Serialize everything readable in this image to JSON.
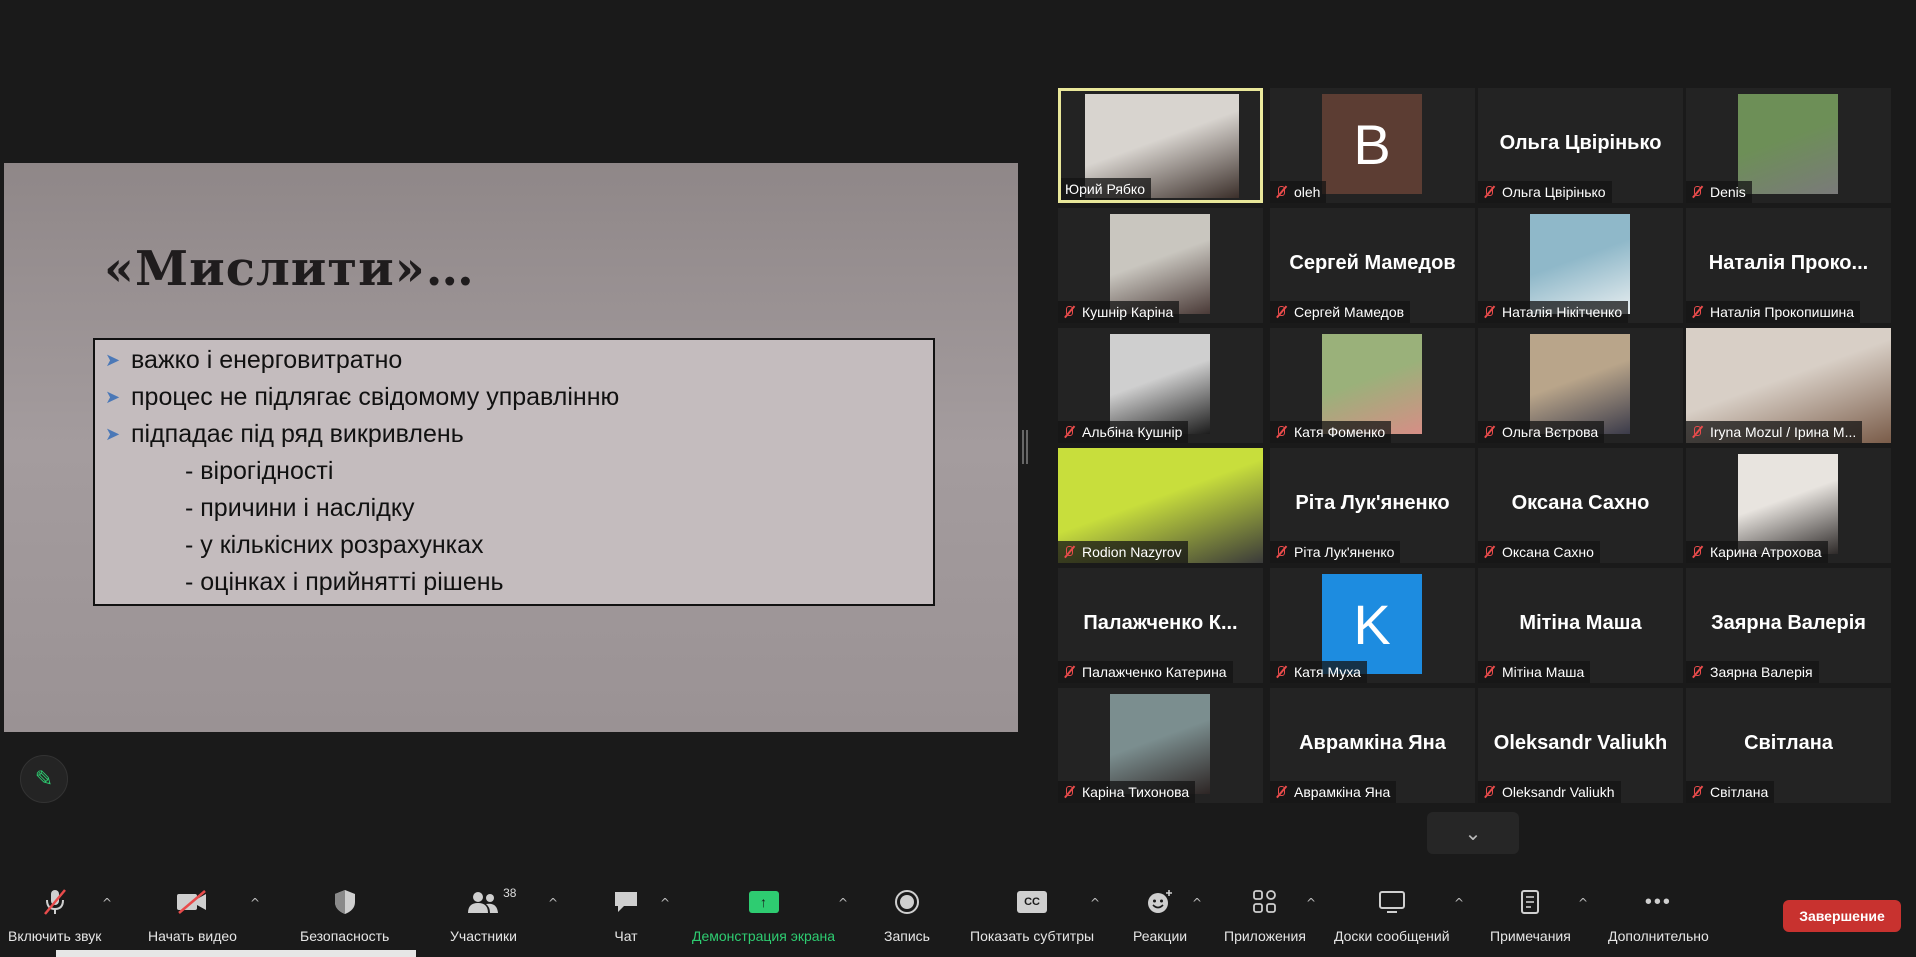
{
  "slide": {
    "title": "«Мислити»…",
    "bullets": [
      "важко і енерговитратно",
      "процес не підлягає свідомому управлінню",
      "підпадає під ряд викривлень"
    ],
    "sub_items": [
      "- вірогідності",
      "- причини і наслідку",
      "- у кількісних розрахунках",
      "- оцінках і прийнятті рішень"
    ]
  },
  "participants": [
    {
      "label": "Юрий Рябко",
      "kind": "video",
      "active": true,
      "muted": false,
      "colors": [
        "#d8d4cf",
        "#3b2f2a"
      ]
    },
    {
      "label": "oleh",
      "kind": "avatar",
      "letter": "B",
      "avatar_color": "#5c3d33",
      "muted": true
    },
    {
      "label": "Ольга Цвірінько",
      "kind": "name",
      "display": "Ольга Цвірінько",
      "muted": true
    },
    {
      "label": "Denis",
      "kind": "video",
      "muted": true,
      "colors": [
        "#6d8f57",
        "#7a7a7a"
      ]
    },
    {
      "label": "Кушнір Каріна",
      "kind": "video",
      "muted": true,
      "colors": [
        "#c9c6bf",
        "#4a3a37"
      ]
    },
    {
      "label": "Сергей Мамедов",
      "kind": "name",
      "display": "Сергей Мамедов",
      "muted": true
    },
    {
      "label": "Наталія Нікітченко",
      "kind": "video",
      "muted": true,
      "colors": [
        "#8fb8c9",
        "#e8eef0"
      ]
    },
    {
      "label": "Наталія Прокопишина",
      "kind": "name",
      "display": "Наталія Проко...",
      "muted": true
    },
    {
      "label": "Альбіна Кушнір",
      "kind": "video",
      "muted": true,
      "colors": [
        "#cfcfcf",
        "#1c1c1c"
      ]
    },
    {
      "label": "Катя Фоменко",
      "kind": "video",
      "muted": true,
      "colors": [
        "#9ab17a",
        "#d68e86"
      ]
    },
    {
      "label": "Ольга Вєтрова",
      "kind": "video",
      "muted": true,
      "colors": [
        "#b9a58a",
        "#3b3b4a"
      ]
    },
    {
      "label": "Iryna Mozul / Ірина М...",
      "kind": "video",
      "muted": true,
      "colors": [
        "#d8cfc6",
        "#7a5c49"
      ]
    },
    {
      "label": "Rodion Nazyrov",
      "kind": "video",
      "muted": true,
      "colors": [
        "#c8de3c",
        "#3a3a3a"
      ]
    },
    {
      "label": "Ріта Лук'яненко",
      "kind": "name",
      "display": "Ріта Лук'яненко",
      "muted": true
    },
    {
      "label": "Оксана Сахно",
      "kind": "name",
      "display": "Оксана Сахно",
      "muted": true
    },
    {
      "label": "Карина Атрохова",
      "kind": "video",
      "muted": true,
      "colors": [
        "#e8e4df",
        "#2e2a29"
      ]
    },
    {
      "label": "Палажченко Катерина",
      "kind": "name",
      "display": "Палажченко К...",
      "muted": true
    },
    {
      "label": "Катя Муха",
      "kind": "avatar",
      "letter": "K",
      "avatar_color": "#1d8ce0",
      "muted": true
    },
    {
      "label": "Мітіна Маша",
      "kind": "name",
      "display": "Мітіна Маша",
      "muted": true
    },
    {
      "label": "Заярна Валерія",
      "kind": "name",
      "display": "Заярна Валерія",
      "muted": true
    },
    {
      "label": "Каріна Тихонова",
      "kind": "video",
      "muted": true,
      "colors": [
        "#7b8e8f",
        "#2d2524"
      ]
    },
    {
      "label": "Аврамкіна Яна",
      "kind": "name",
      "display": "Аврамкіна Яна",
      "muted": true
    },
    {
      "label": "Oleksandr Valiukh",
      "kind": "name",
      "display": "Oleksandr Valiukh",
      "muted": true
    },
    {
      "label": "Світлана",
      "kind": "name",
      "display": "Світлана",
      "muted": true
    }
  ],
  "toolbar": {
    "unmute": "Включить звук",
    "video": "Начать видео",
    "security": "Безопасность",
    "participants": "Участники",
    "participants_count": "38",
    "chat": "Чат",
    "share": "Демонстрация экрана",
    "record": "Запись",
    "captions": "Показать субтитры",
    "captions_icon": "CC",
    "reactions": "Реакции",
    "apps": "Приложения",
    "whiteboards": "Доски сообщений",
    "notes": "Примечания",
    "more": "Дополнительно",
    "end": "Завершение"
  },
  "colors": {
    "accent_green": "#2ecc71",
    "end_red": "#c8322f",
    "active_border": "#e9e79a",
    "muted_red": "#e84b4b"
  }
}
